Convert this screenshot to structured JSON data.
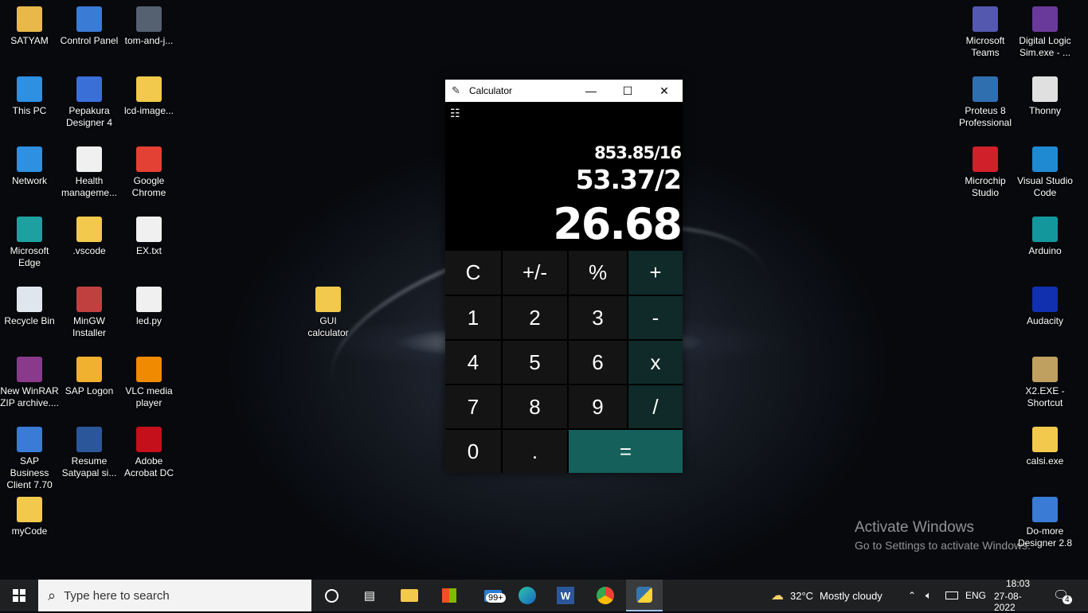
{
  "desktop": {
    "icons_left": [
      {
        "label": "SATYAM",
        "icon": "user-folder-icon",
        "color": "#e8b84a"
      },
      {
        "label": "Control Panel",
        "icon": "control-panel-icon",
        "color": "#3a7bd5"
      },
      {
        "label": "tom-and-j...",
        "icon": "image-file-icon",
        "color": "#556070"
      },
      {
        "label": "This PC",
        "icon": "computer-icon",
        "color": "#2f8fe0"
      },
      {
        "label": "Pepakura Designer 4",
        "icon": "pepakura-icon",
        "color": "#3a6fd8"
      },
      {
        "label": "lcd-image...",
        "icon": "folder-icon",
        "color": "#f2c94c"
      },
      {
        "label": "Network",
        "icon": "network-icon",
        "color": "#2f8fe0"
      },
      {
        "label": "Health manageme...",
        "icon": "document-icon",
        "color": "#f0f0f0"
      },
      {
        "label": "Google Chrome",
        "icon": "chrome-icon",
        "color": "#e34133"
      },
      {
        "label": "Microsoft Edge",
        "icon": "edge-icon",
        "color": "#1fa0a0"
      },
      {
        "label": ".vscode",
        "icon": "folder-icon",
        "color": "#f2c94c"
      },
      {
        "label": "EX.txt",
        "icon": "text-file-icon",
        "color": "#f0f0f0"
      },
      {
        "label": "Recycle Bin",
        "icon": "recycle-bin-icon",
        "color": "#dfe6ee"
      },
      {
        "label": "MinGW Installer",
        "icon": "installer-icon",
        "color": "#c04040"
      },
      {
        "label": "led.py",
        "icon": "python-file-icon",
        "color": "#f0f0f0"
      },
      {
        "label": "New WinRAR ZIP archive....",
        "icon": "winrar-icon",
        "color": "#8a3a8a"
      },
      {
        "label": "SAP Logon",
        "icon": "sap-logon-icon",
        "color": "#f0b030"
      },
      {
        "label": "VLC media player",
        "icon": "vlc-icon",
        "color": "#f08a00"
      },
      {
        "label": "SAP Business Client 7.70",
        "icon": "sap-business-client-icon",
        "color": "#3a7bd5"
      },
      {
        "label": "Resume Satyapal si...",
        "icon": "word-document-icon",
        "color": "#2b579a"
      },
      {
        "label": "Adobe Acrobat DC",
        "icon": "acrobat-icon",
        "color": "#c3101a"
      },
      {
        "label": "myCode",
        "icon": "folder-icon",
        "color": "#f2c94c"
      }
    ],
    "icon_middle": {
      "label": "GUI calculator",
      "icon": "folder-icon",
      "color": "#f2c94c"
    },
    "icons_right": [
      {
        "label": "Microsoft Teams",
        "icon": "teams-icon",
        "color": "#5558af"
      },
      {
        "label": "Digital Logic Sim.exe - ...",
        "icon": "digital-logic-icon",
        "color": "#6a3a9a"
      },
      {
        "label": "Proteus 8 Professional",
        "icon": "proteus-icon",
        "color": "#2f6fb0"
      },
      {
        "label": "Thonny",
        "icon": "thonny-icon",
        "color": "#e0e0e0"
      },
      {
        "label": "Microchip Studio",
        "icon": "microchip-icon",
        "color": "#d0202a"
      },
      {
        "label": "Visual Studio Code",
        "icon": "vscode-icon",
        "color": "#1f8ad2"
      },
      {
        "label": "Arduino",
        "icon": "arduino-icon",
        "color": "#13979c"
      },
      {
        "label": "Audacity",
        "icon": "audacity-icon",
        "color": "#1030b0"
      },
      {
        "label": "X2.EXE - Shortcut",
        "icon": "x2-icon",
        "color": "#c0a060"
      },
      {
        "label": "calsi.exe",
        "icon": "python-exe-icon",
        "color": "#f2c94c"
      },
      {
        "label": "Do-more Designer 2.8",
        "icon": "domore-icon",
        "color": "#3a7bd5"
      }
    ]
  },
  "calculator": {
    "title": "Calculator",
    "minimize_glyph": "—",
    "maximize_glyph": "☐",
    "close_glyph": "✕",
    "menu_glyph": "☷",
    "history_line": "853.85/16",
    "expression": "53.37/2",
    "result": "26.68",
    "keys": {
      "clear": "C",
      "negate": "+/-",
      "percent": "%",
      "add": "+",
      "one": "1",
      "two": "2",
      "three": "3",
      "subtract": "-",
      "four": "4",
      "five": "5",
      "six": "6",
      "multiply": "x",
      "seven": "7",
      "eight": "8",
      "nine": "9",
      "divide": "/",
      "zero": "0",
      "decimal": ".",
      "equals": "="
    },
    "colors": {
      "operator_bg": "#0f2a28",
      "equals_bg": "#15605a",
      "digit_bg": "#141414"
    }
  },
  "watermark": {
    "line1": "Activate Windows",
    "line2": "Go to Settings to activate Windows."
  },
  "taskbar": {
    "search_placeholder": "Type here to search",
    "mail_badge": "99+",
    "weather_temp": "32°C",
    "weather_text": "Mostly cloudy",
    "language": "ENG",
    "time": "18:03",
    "date": "27-08-2022",
    "notifications": "4"
  }
}
